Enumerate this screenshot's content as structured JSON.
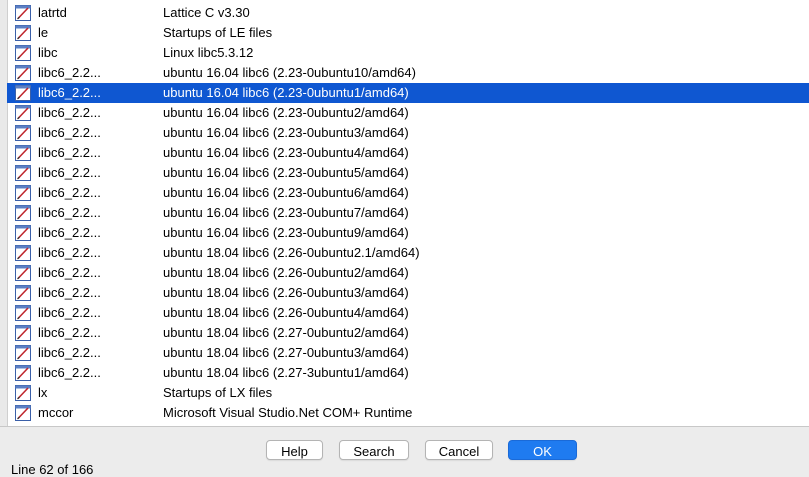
{
  "list": {
    "selected_index": 4,
    "rows": [
      {
        "name": "latrtd",
        "desc": "Lattice C v3.30"
      },
      {
        "name": "le",
        "desc": "Startups of LE files"
      },
      {
        "name": "libc",
        "desc": "Linux libc5.3.12"
      },
      {
        "name": "libc6_2.2...",
        "desc": "ubuntu 16.04 libc6 (2.23-0ubuntu10/amd64)"
      },
      {
        "name": "libc6_2.2...",
        "desc": "ubuntu 16.04 libc6 (2.23-0ubuntu1/amd64)"
      },
      {
        "name": "libc6_2.2...",
        "desc": "ubuntu 16.04 libc6 (2.23-0ubuntu2/amd64)"
      },
      {
        "name": "libc6_2.2...",
        "desc": "ubuntu 16.04 libc6 (2.23-0ubuntu3/amd64)"
      },
      {
        "name": "libc6_2.2...",
        "desc": "ubuntu 16.04 libc6 (2.23-0ubuntu4/amd64)"
      },
      {
        "name": "libc6_2.2...",
        "desc": "ubuntu 16.04 libc6 (2.23-0ubuntu5/amd64)"
      },
      {
        "name": "libc6_2.2...",
        "desc": "ubuntu 16.04 libc6 (2.23-0ubuntu6/amd64)"
      },
      {
        "name": "libc6_2.2...",
        "desc": "ubuntu 16.04 libc6 (2.23-0ubuntu7/amd64)"
      },
      {
        "name": "libc6_2.2...",
        "desc": "ubuntu 16.04 libc6 (2.23-0ubuntu9/amd64)"
      },
      {
        "name": "libc6_2.2...",
        "desc": "ubuntu 18.04 libc6 (2.26-0ubuntu2.1/amd64)"
      },
      {
        "name": "libc6_2.2...",
        "desc": "ubuntu 18.04 libc6 (2.26-0ubuntu2/amd64)"
      },
      {
        "name": "libc6_2.2...",
        "desc": "ubuntu 18.04 libc6 (2.26-0ubuntu3/amd64)"
      },
      {
        "name": "libc6_2.2...",
        "desc": "ubuntu 18.04 libc6 (2.26-0ubuntu4/amd64)"
      },
      {
        "name": "libc6_2.2...",
        "desc": "ubuntu 18.04 libc6 (2.27-0ubuntu2/amd64)"
      },
      {
        "name": "libc6_2.2...",
        "desc": "ubuntu 18.04 libc6 (2.27-0ubuntu3/amd64)"
      },
      {
        "name": "libc6_2.2...",
        "desc": "ubuntu 18.04 libc6 (2.27-3ubuntu1/amd64)"
      },
      {
        "name": "lx",
        "desc": "Startups of LX files"
      },
      {
        "name": "mccor",
        "desc": "Microsoft Visual Studio.Net COM+ Runtime"
      }
    ],
    "row_icon": "signature-file-icon"
  },
  "buttons": {
    "help": "Help",
    "search": "Search",
    "cancel": "Cancel",
    "ok": "OK"
  },
  "status": {
    "text": "Line 62 of 166"
  },
  "colors": {
    "selection": "#0f57d1",
    "ok_button": "#1f7bf0",
    "window_bg": "#ececec"
  }
}
